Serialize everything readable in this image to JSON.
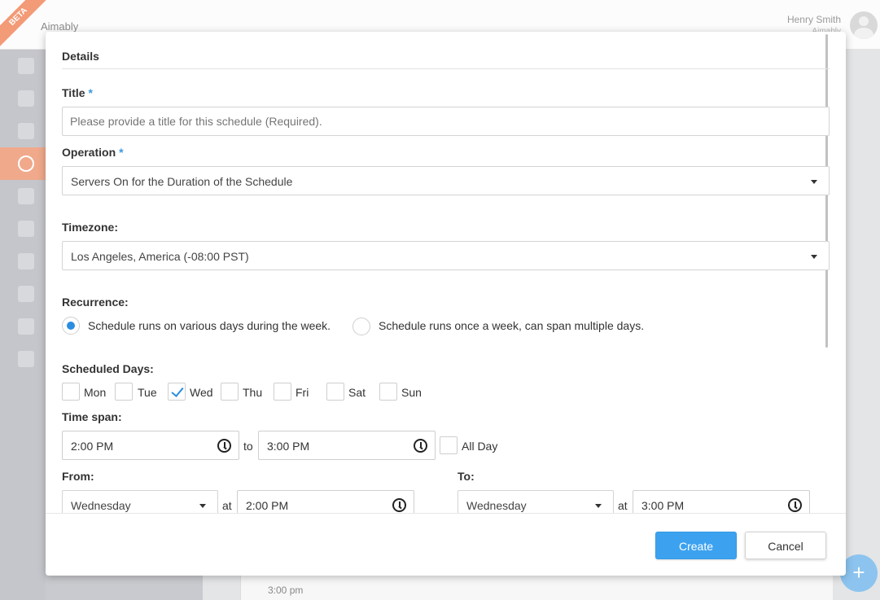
{
  "app": {
    "beta_label": "BETA",
    "brand_name": "Aimably",
    "user_name": "Henry Smith",
    "user_org": "Aimably",
    "calendar_time_label": "3:00 pm",
    "fab_symbol": "+"
  },
  "sidebar": {
    "items": [
      {
        "name": "home-icon"
      },
      {
        "name": "cloud-icon"
      },
      {
        "name": "chart-icon"
      },
      {
        "name": "clock-icon",
        "active": true
      },
      {
        "name": "laptop-icon"
      },
      {
        "name": "users-icon"
      },
      {
        "name": "bell-icon"
      },
      {
        "name": "gear-icon"
      },
      {
        "name": "archive-icon"
      },
      {
        "name": "help-icon"
      }
    ],
    "active_color": "#f0a98b"
  },
  "modal": {
    "section_title": "Details",
    "title_label": "Title",
    "required_mark": "*",
    "title_placeholder": "Please provide a title for this schedule (Required).",
    "title_value": "",
    "operation_label": "Operation",
    "operation_value": "Servers On for the Duration of the Schedule",
    "timezone_label": "Timezone:",
    "timezone_value": "Los Angeles, America (-08:00 PST)",
    "recurrence_label": "Recurrence:",
    "recurrence_options": [
      {
        "label": "Schedule runs on various days during the week.",
        "selected": true
      },
      {
        "label": "Schedule runs once a week, can span multiple days.",
        "selected": false
      }
    ],
    "scheduled_days_label": "Scheduled Days:",
    "days": [
      {
        "label": "Mon",
        "checked": false
      },
      {
        "label": "Tue",
        "checked": false
      },
      {
        "label": "Wed",
        "checked": true
      },
      {
        "label": "Thu",
        "checked": false
      },
      {
        "label": "Fri",
        "checked": false
      },
      {
        "label": "Sat",
        "checked": false
      },
      {
        "label": "Sun",
        "checked": false
      }
    ],
    "time_span_label": "Time span:",
    "time_span_start": "2:00 PM",
    "time_span_to": "to",
    "time_span_end": "3:00 PM",
    "all_day_label": "All Day",
    "all_day_checked": false,
    "from_label": "From:",
    "from_day": "Wednesday",
    "from_at": "at",
    "from_time": "2:00 PM",
    "to_label": "To:",
    "to_day": "Wednesday",
    "to_at": "at",
    "to_time": "3:00 PM",
    "create_button": "Create",
    "cancel_button": "Cancel",
    "accent_color": "#3ca2f0"
  }
}
